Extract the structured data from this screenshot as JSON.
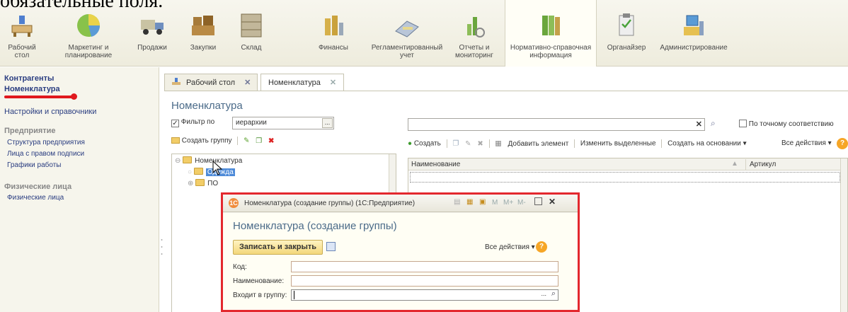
{
  "caption": "обязательные поля.",
  "sections": [
    {
      "label": "Рабочий\nстол",
      "icon": "desk-icon"
    },
    {
      "label": "Маркетинг и\nпланирование",
      "icon": "pie-chart-icon"
    },
    {
      "label": "Продажи",
      "icon": "truck-icon"
    },
    {
      "label": "Закупки",
      "icon": "boxes-icon"
    },
    {
      "label": "Склад",
      "icon": "warehouse-icon"
    },
    {
      "label": "Финансы",
      "icon": "coins-icon"
    },
    {
      "label": "Регламентированный\nучет",
      "icon": "accounting-icon"
    },
    {
      "label": "Отчеты и\nмониторинг",
      "icon": "report-icon"
    },
    {
      "label": "Нормативно-справочная\nинформация",
      "icon": "reference-books-icon"
    },
    {
      "label": "Органайзер",
      "icon": "clipboard-icon"
    },
    {
      "label": "Администрирование",
      "icon": "computer-icon"
    }
  ],
  "left_nav": {
    "top_items": [
      "Контрагенты",
      "Номенклатура"
    ],
    "settings": "Настройки и справочники",
    "enterprise_head": "Предприятие",
    "enterprise_items": [
      "Структура предприятия",
      "Лица с правом подписи",
      "Графики работы"
    ],
    "persons_head": "Физические лица",
    "persons_items": [
      "Физические лица"
    ]
  },
  "tabs": [
    {
      "label": "Рабочий стол"
    },
    {
      "label": "Номенклатура"
    }
  ],
  "form": {
    "title": "Номенклатура",
    "filter_label": "Фильтр по",
    "filter_value": "иерархии",
    "create_group": "Создать группу",
    "tree": [
      "Номенклатура",
      "Одежда",
      "ПО"
    ],
    "toolbar": {
      "create": "Создать",
      "add_element": "Добавить элемент",
      "edit_selected": "Изменить выделенные",
      "create_based_on": "Создать на основании ▾",
      "all_actions": "Все действия ▾"
    },
    "exact_match": "По точному соответствию",
    "columns": [
      "Наименование",
      "Артикул"
    ]
  },
  "modal": {
    "window_title": "Номенклатура (создание группы)  (1С:Предприятие)",
    "title_buttons": [
      "M",
      "M+",
      "M-"
    ],
    "form_title": "Номенклатура (создание группы)",
    "save_close": "Записать и закрыть",
    "all_actions": "Все действия ▾",
    "code_label": "Код:",
    "name_label": "Наименование:",
    "group_label": "Входит в группу:"
  },
  "colors": {
    "accent_red": "#e3282e",
    "title_blue": "#4b6b89",
    "nav_blue": "#2a3d80"
  }
}
